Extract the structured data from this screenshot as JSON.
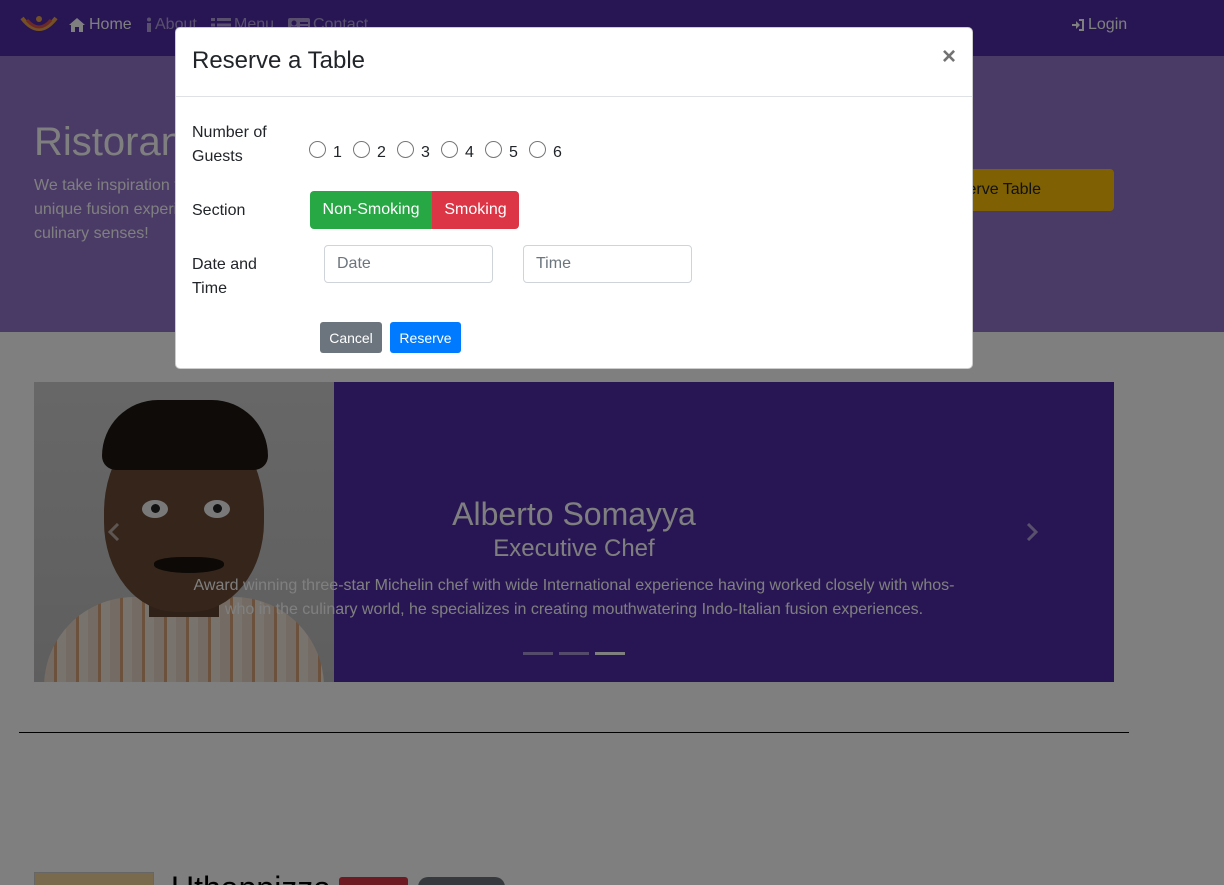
{
  "navbar": {
    "items": [
      {
        "label": "Home",
        "icon": "home-icon"
      },
      {
        "label": "About",
        "icon": "info-icon"
      },
      {
        "label": "Menu",
        "icon": "list-icon"
      },
      {
        "label": "Contact",
        "icon": "address-card-icon"
      }
    ],
    "login": {
      "label": "Login",
      "icon": "sign-in-icon"
    }
  },
  "jumbotron": {
    "title": "Ristorante con Fusion",
    "text": "We take inspiration from the World's best cuisines, and create a unique fusion experience. Our lipsmacking creations will tickle your culinary senses!",
    "reserve_label": "Reserve Table"
  },
  "carousel": {
    "name": "Alberto Somayya",
    "role": "Executive Chef",
    "description": "Award winning three-star Michelin chef with wide International experience having worked closely with whos-who in the culinary world, he specializes in creating mouthwatering Indo-Italian fusion experiences.",
    "active_slide": 3,
    "slide_count": 3
  },
  "partial": {
    "title": "Uthappizza"
  },
  "modal": {
    "title": "Reserve a Table",
    "close": "×",
    "guests_label": "Number of Guests",
    "guest_options": [
      "1",
      "2",
      "3",
      "4",
      "5",
      "6"
    ],
    "section_label": "Section",
    "section_options": [
      "Non-Smoking",
      "Smoking"
    ],
    "datetime_label": "Date and Time",
    "date_placeholder": "Date",
    "time_placeholder": "Time",
    "cancel_label": "Cancel",
    "reserve_label": "Reserve"
  },
  "colors": {
    "primary": "#512da8",
    "light_primary": "#9575cd",
    "warning": "#ffc107",
    "success": "#28a745",
    "danger": "#dc3545",
    "info_btn": "#007bff",
    "secondary": "#6c757d"
  }
}
